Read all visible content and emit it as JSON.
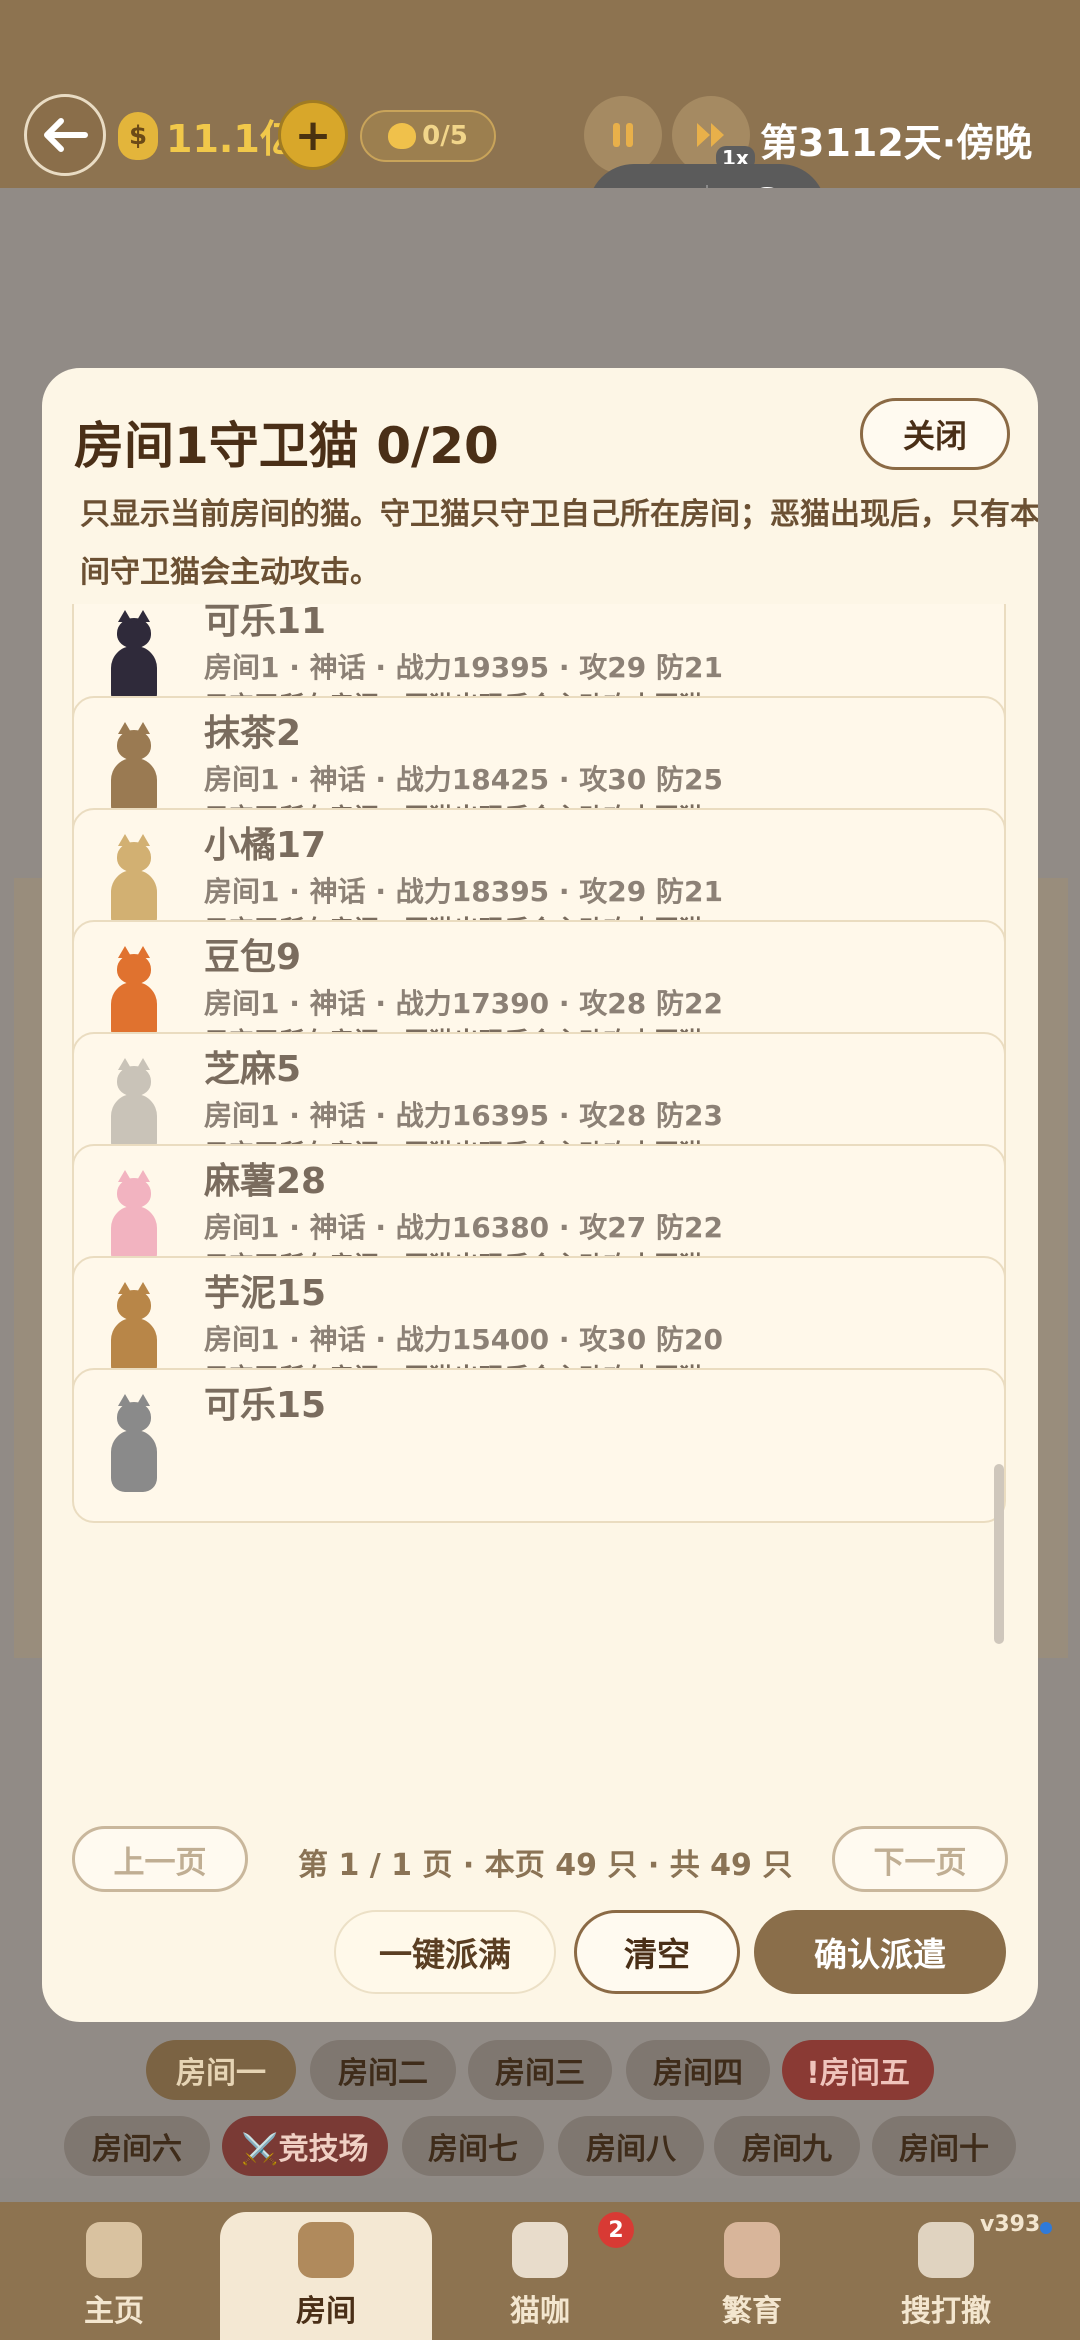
{
  "header": {
    "money": "11.1亿",
    "plus_label": "+",
    "cat_count": "0/5",
    "speed": "1x",
    "day_info": "第3112天·傍晚"
  },
  "modal": {
    "title": "房间1守卫猫 0/20",
    "close_label": "关闭",
    "description": "只显示当前房间的猫。守卫猫只守卫自己所在房间；恶猫出现后，只有本房间守卫猫会主动攻击。"
  },
  "cats": [
    {
      "name": "可乐11",
      "stats": "房间1 · 神话 · 战力19395 · 攻29 防21",
      "note": "只守卫所在房间；恶猫出现后会主动攻击恶猫。",
      "color": "#2f2a3a"
    },
    {
      "name": "抹茶2",
      "stats": "房间1 · 神话 · 战力18425 · 攻30 防25",
      "note": "只守卫所在房间；恶猫出现后会主动攻击恶猫。",
      "color": "#9a7a52"
    },
    {
      "name": "小橘17",
      "stats": "房间1 · 神话 · 战力18395 · 攻29 防21",
      "note": "只守卫所在房间；恶猫出现后会主动攻击恶猫。",
      "color": "#d2b072"
    },
    {
      "name": "豆包9",
      "stats": "房间1 · 神话 · 战力17390 · 攻28 防22",
      "note": "只守卫所在房间；恶猫出现后会主动攻击恶猫。",
      "color": "#e0722f"
    },
    {
      "name": "芝麻5",
      "stats": "房间1 · 神话 · 战力16395 · 攻28 防23",
      "note": "只守卫所在房间；恶猫出现后会主动攻击恶猫。",
      "color": "#c9c3b8"
    },
    {
      "name": "麻薯28",
      "stats": "房间1 · 神话 · 战力16380 · 攻27 防22",
      "note": "只守卫所在房间；恶猫出现后会主动攻击恶猫。",
      "color": "#f2b3c0"
    },
    {
      "name": "芋泥15",
      "stats": "房间1 · 神话 · 战力15400 · 攻30 防20",
      "note": "只守卫所在房间；恶猫出现后会主动攻击恶猫。",
      "color": "#b88648"
    },
    {
      "name": "可乐15",
      "stats": "",
      "note": "",
      "color": "#8a8a8a"
    }
  ],
  "pager": {
    "prev_label": "上一页",
    "info": "第 1 / 1 页 · 本页 49 只 · 共 49 只",
    "next_label": "下一页"
  },
  "actions": {
    "fill_label": "一键派满",
    "clear_label": "清空",
    "confirm_label": "确认派遣"
  },
  "rooms": [
    {
      "label": "房间一",
      "state": "active"
    },
    {
      "label": "房间二",
      "state": ""
    },
    {
      "label": "房间三",
      "state": ""
    },
    {
      "label": "房间四",
      "state": ""
    },
    {
      "label": "!房间五",
      "state": "alert"
    },
    {
      "label": "房间六",
      "state": ""
    },
    {
      "label": "⚔️竞技场",
      "state": "arena"
    },
    {
      "label": "房间七",
      "state": ""
    },
    {
      "label": "房间八",
      "state": ""
    },
    {
      "label": "房间九",
      "state": ""
    },
    {
      "label": "房间十",
      "state": ""
    }
  ],
  "nav": {
    "items": [
      {
        "label": "主页",
        "icon": "house-icon"
      },
      {
        "label": "房间",
        "icon": "bowl-icon"
      },
      {
        "label": "猫咖",
        "icon": "cat-cup-icon"
      },
      {
        "label": "繁育",
        "icon": "cats-pair-icon"
      },
      {
        "label": "搜打撤",
        "icon": "magnifier-icon"
      }
    ],
    "badge": "2",
    "version": "v393"
  }
}
